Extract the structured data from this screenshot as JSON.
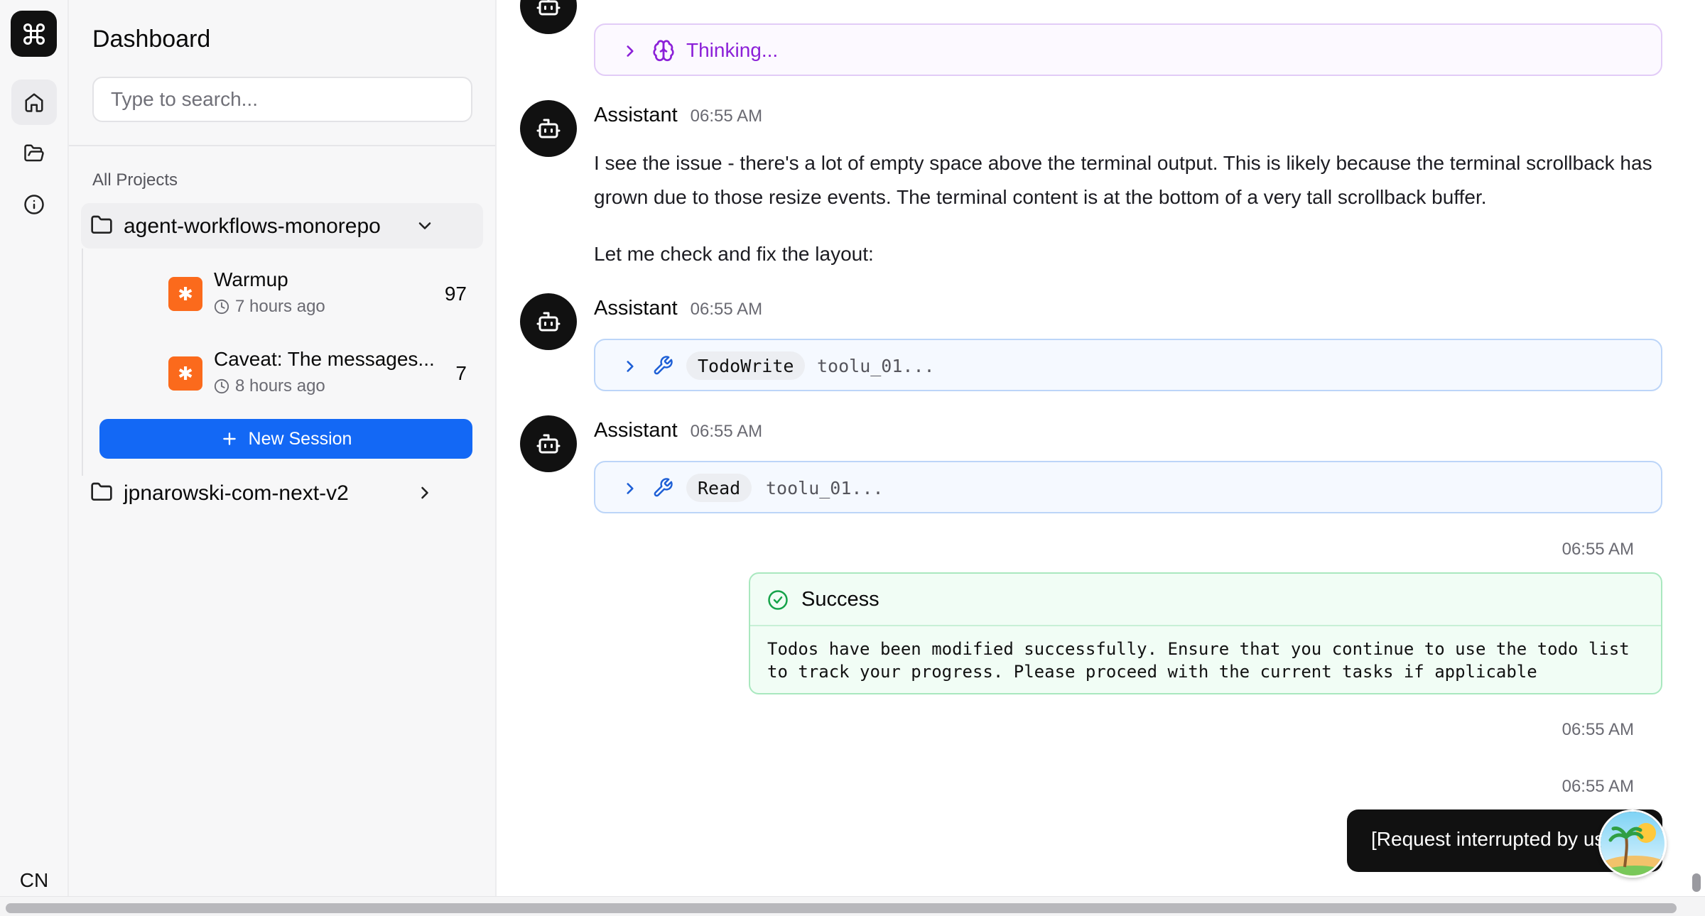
{
  "rail": {
    "logo_icon": "command-icon",
    "nav": [
      {
        "name": "home",
        "icon": "home-icon",
        "active": true
      },
      {
        "name": "projects",
        "icon": "folder-open-icon",
        "active": false
      },
      {
        "name": "about",
        "icon": "info-icon",
        "active": false
      }
    ],
    "language": "CN"
  },
  "sidebar": {
    "title": "Dashboard",
    "search_placeholder": "Type to search...",
    "section_label": "All Projects",
    "projects": [
      {
        "name": "agent-workflows-monorepo",
        "expanded": true
      },
      {
        "name": "jpnarowski-com-next-v2",
        "expanded": false
      }
    ],
    "sessions": [
      {
        "title": "Warmup",
        "time": "7 hours ago",
        "count": "97",
        "badge": "✱"
      },
      {
        "title": "Caveat: The messages...",
        "time": "8 hours ago",
        "count": "7",
        "badge": "✱"
      }
    ],
    "new_session_label": "New Session"
  },
  "chat": {
    "thinking": {
      "label": "Thinking..."
    },
    "messages": [
      {
        "author": "Assistant",
        "time": "06:55 AM",
        "paragraphs": [
          "I see the issue - there's a lot of empty space above the terminal output. This is likely because the terminal scrollback has grown due to those resize events. The terminal content is at the bottom of a very tall scrollback buffer.",
          "Let me check and fix the layout:"
        ]
      },
      {
        "author": "Assistant",
        "time": "06:55 AM",
        "tool": "TodoWrite",
        "tool_id": "toolu_01..."
      },
      {
        "author": "Assistant",
        "time": "06:55 AM",
        "tool": "Read",
        "tool_id": "toolu_01..."
      }
    ],
    "result": {
      "time": "06:55 AM",
      "status": "Success",
      "body": "Todos have been modified successfully. Ensure that you continue to use the todo list to track your progress. Please proceed with the current tasks if applicable"
    },
    "timestamps_right": [
      "06:55 AM",
      "06:55 AM"
    ],
    "user_message": "[Request interrupted by user]"
  },
  "colors": {
    "primary_button": "#1368f5",
    "session_badge": "#fb6a1c",
    "thinking_accent": "#8b20d8",
    "tool_border": "#bcd5f8",
    "success_border": "#a9e8bf",
    "success_icon": "#16a34a"
  }
}
